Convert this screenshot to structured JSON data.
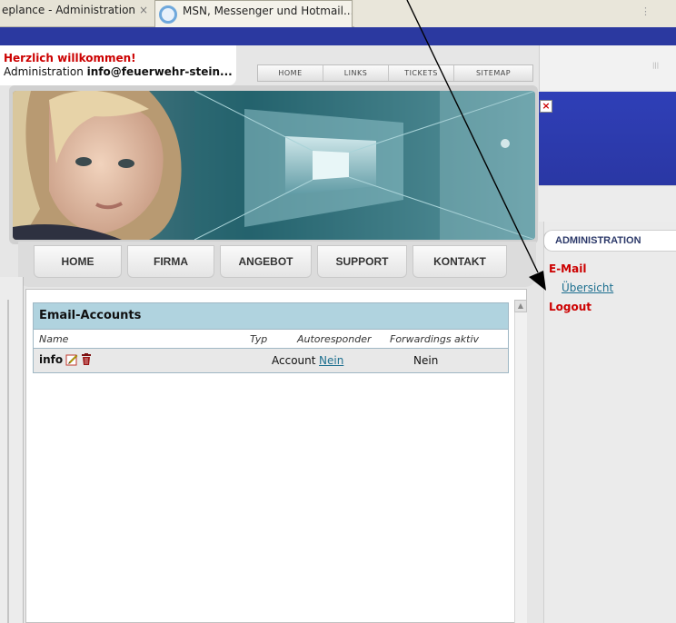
{
  "browser": {
    "tabs": [
      {
        "label": "eplance - Administration",
        "close": "×"
      },
      {
        "label": "MSN, Messenger und Hotmail..."
      }
    ]
  },
  "header": {
    "welcome": "Herzlich willkommen!",
    "admin_prefix": "Administration ",
    "admin_email": "info@feuerwehr-stein..."
  },
  "top_nav": [
    "HOME",
    "LINKS",
    "TICKETS",
    "SITEMAP"
  ],
  "main_nav": [
    "HOME",
    "FIRMA",
    "ANGEBOT",
    "SUPPORT",
    "KONTAKT"
  ],
  "close_button": "×",
  "table": {
    "title": "Email-Accounts",
    "columns": [
      "Name",
      "Typ",
      "Autoresponder",
      "Forwardings aktiv"
    ],
    "rows": [
      {
        "name": "info",
        "typ": "Account",
        "autoresponder": "Nein",
        "forwarding": "Nein"
      }
    ]
  },
  "sidebar": {
    "header": "ADMINISTRATION",
    "email_label": "E-Mail",
    "uebersicht": "Übersicht",
    "logout": "Logout"
  },
  "colors": {
    "navy": "#2b39a0",
    "brand_red": "#cc0000",
    "link_teal": "#1d6f8f",
    "table_header": "#b0d3df"
  },
  "icons": [
    "msn-icon",
    "edit-icon",
    "delete-icon",
    "close-icon",
    "scroll-up-icon"
  ]
}
